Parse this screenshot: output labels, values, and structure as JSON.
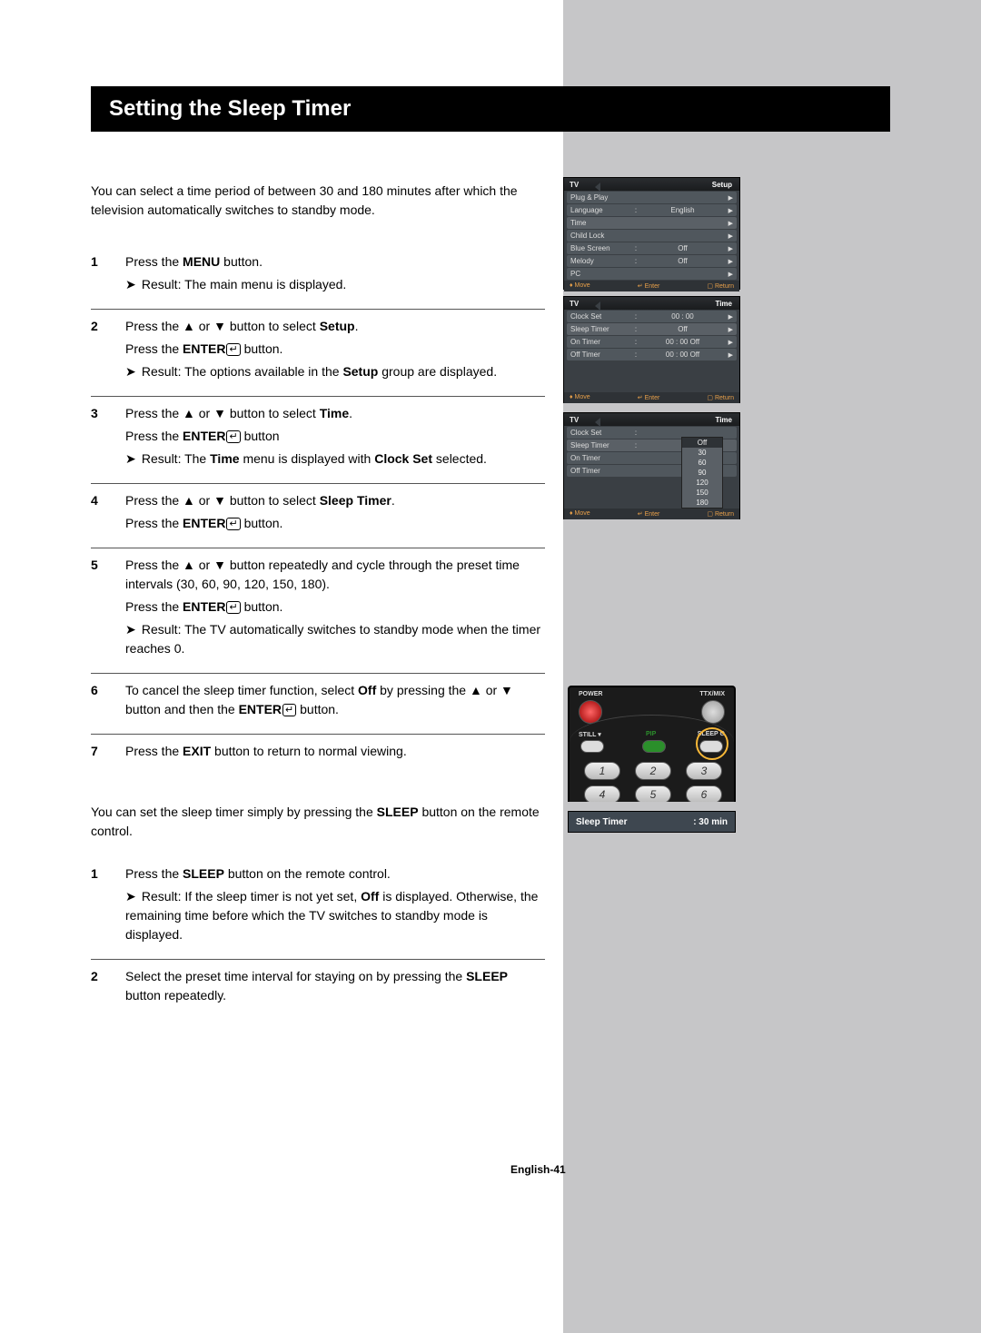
{
  "title": "Setting the Sleep Timer",
  "intro": "You can select a time period of between 30 and 180 minutes after which the television automatically switches to standby mode.",
  "steps": [
    {
      "n": "1",
      "lines": [
        "Press the <b>MENU</b> button."
      ],
      "result": "The main menu is displayed."
    },
    {
      "n": "2",
      "lines": [
        "Press the ▲ or ▼ button to select <b>Setup</b>.",
        "Press the <b>ENTER</b><ent></ent> button."
      ],
      "result": "The options available in the <b>Setup</b> group are displayed."
    },
    {
      "n": "3",
      "lines": [
        "Press the ▲ or ▼ button to select <b>Time</b>.",
        "Press the <b>ENTER</b><ent></ent> button"
      ],
      "result": "The <b>Time</b> menu is displayed with <b>Clock Set</b> selected."
    },
    {
      "n": "4",
      "lines": [
        "Press the ▲ or ▼ button to select <b>Sleep Timer</b>.",
        "Press the <b>ENTER</b><ent></ent> button."
      ]
    },
    {
      "n": "5",
      "lines": [
        "Press the ▲ or ▼ button repeatedly and cycle through the preset time intervals (30, 60, 90, 120, 150, 180).",
        "Press the <b>ENTER</b><ent></ent> button."
      ],
      "result": "The TV automatically switches to standby mode when the timer reaches 0."
    },
    {
      "n": "6",
      "lines": [
        "To cancel the sleep timer function, select <b>Off</b> by pressing the ▲ or ▼ button and then the <b>ENTER</b><ent></ent> button."
      ]
    },
    {
      "n": "7",
      "lines": [
        "Press the <b>EXIT</b> button to return to normal viewing."
      ]
    }
  ],
  "simple_intro": "You can set the sleep timer simply by pressing the <b>SLEEP</b> button on the remote control.",
  "simple_steps": [
    {
      "n": "1",
      "lines": [
        "Press the <b>SLEEP</b> button on the remote control."
      ],
      "result": "If the sleep timer is not yet set, <b>Off</b> is displayed. Otherwise, the remaining time before which the TV switches to standby mode is displayed."
    },
    {
      "n": "2",
      "lines": [
        "Select the preset time interval for staying on by pressing the <b>SLEEP</b> button repeatedly."
      ]
    }
  ],
  "osd1": {
    "tv": "TV",
    "title": "Setup",
    "rows": [
      {
        "lab": "Plug & Play",
        "val": "",
        "chev": "▶"
      },
      {
        "lab": "Language",
        "colon": ":",
        "val": "English",
        "chev": "▶"
      },
      {
        "lab": "Time",
        "val": "",
        "chev": "▶",
        "hl": true
      },
      {
        "lab": "Child Lock",
        "val": "",
        "chev": "▶"
      },
      {
        "lab": "Blue Screen",
        "colon": ":",
        "val": "Off",
        "chev": "▶"
      },
      {
        "lab": "Melody",
        "colon": ":",
        "val": "Off",
        "chev": "▶"
      },
      {
        "lab": "PC",
        "val": "",
        "chev": "▶"
      }
    ],
    "foot": {
      "move": "Move",
      "enter": "Enter",
      "return": "Return"
    }
  },
  "osd2": {
    "tv": "TV",
    "title": "Time",
    "rows": [
      {
        "lab": "Clock Set",
        "colon": ":",
        "val": "00 : 00",
        "chev": "▶"
      },
      {
        "lab": "Sleep Timer",
        "colon": ":",
        "val": "Off",
        "chev": "▶",
        "hl": true
      },
      {
        "lab": "On Timer",
        "colon": ":",
        "val": "00 : 00    Off",
        "chev": "▶"
      },
      {
        "lab": "Off Timer",
        "colon": ":",
        "val": "00 : 00    Off",
        "chev": "▶"
      }
    ],
    "foot": {
      "move": "Move",
      "enter": "Enter",
      "return": "Return"
    }
  },
  "osd3": {
    "tv": "TV",
    "title": "Time",
    "rows": [
      {
        "lab": "Clock Set",
        "colon": ":",
        "val": "",
        "chev": ""
      },
      {
        "lab": "Sleep Timer",
        "colon": ":",
        "val": "",
        "chev": "",
        "hl": true
      },
      {
        "lab": "On Timer",
        "val": "",
        "chev": ""
      },
      {
        "lab": "Off Timer",
        "val": "",
        "chev": ""
      }
    ],
    "drop": [
      "Off",
      "30",
      "60",
      "90",
      "120",
      "150",
      "180"
    ],
    "foot": {
      "move": "Move",
      "enter": "Enter",
      "return": "Return"
    }
  },
  "remote": {
    "power": "POWER",
    "ttxmix": "TTX/MIX",
    "still": "STILL",
    "pip": "PIP",
    "sleep": "SLEEP",
    "nums": [
      "1",
      "2",
      "3",
      "4",
      "5",
      "6"
    ]
  },
  "sleep_bar": {
    "label": "Sleep Timer",
    "value": ": 30 min"
  },
  "footer": "English-41"
}
